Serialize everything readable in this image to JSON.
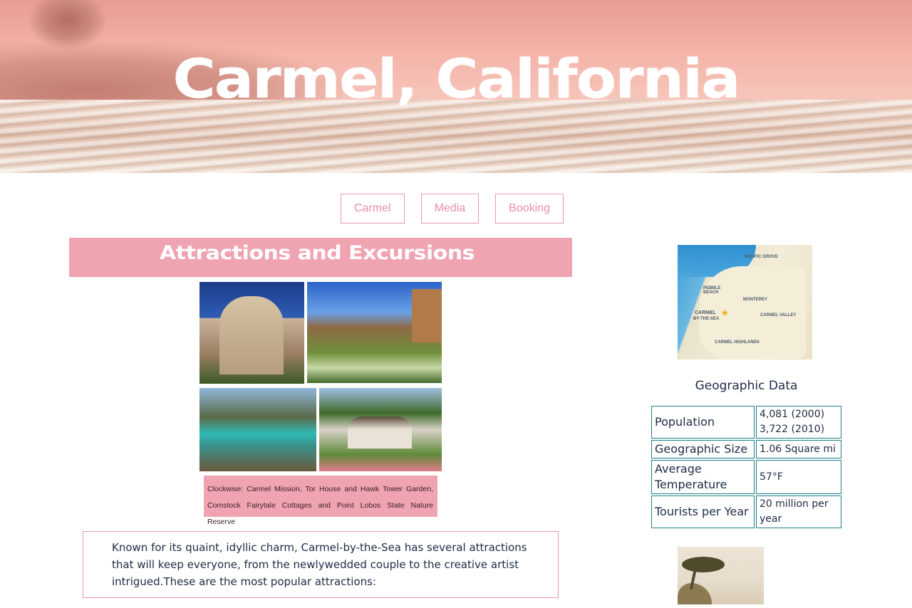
{
  "header": {
    "title": "Carmel, California"
  },
  "nav": {
    "items": [
      {
        "label": "Carmel"
      },
      {
        "label": "Media"
      },
      {
        "label": "Booking"
      }
    ]
  },
  "main": {
    "section_heading": "Attractions and Excursions",
    "photo_caption": "Clockwise: Carmel Mission, Tor House and Hawk Tower Garden, Comstock Fairytale Cottages and Point Lobos State Nature Reserve",
    "intro": "Known for its quaint, idyllic charm, Carmel-by-the-Sea has several attractions that will keep everyone, from the newlywedded couple to the creative artist intrigued.These are the most popular attractions:"
  },
  "sidebar": {
    "map_labels": {
      "pacific_grove": "PACIFIC GROVE",
      "pebble_beach": "PEBBLE BEACH",
      "monterey": "MONTEREY",
      "carmel": "CARMEL",
      "by_the_sea": "BY-THE-SEA",
      "carmel_valley": "CARMEL VALLEY",
      "carmel_highlands": "CARMEL HIGHLANDS"
    },
    "geo_title": "Geographic Data",
    "geo_rows": [
      {
        "key": "Population",
        "value_line1": "4,081 (2000)",
        "value_line2": "3,722 (2010)"
      },
      {
        "key": "Geographic Size",
        "value": "1.06 Square mi"
      },
      {
        "key": "Average Temperature",
        "value": "57°F"
      },
      {
        "key": "Tourists per Year",
        "value": "20 million per year"
      }
    ]
  },
  "colors": {
    "accent_pink": "#f0a3b0",
    "nav_border": "#e89aa8",
    "table_border": "#1f7e8c",
    "text_dark": "#1f2a44"
  }
}
